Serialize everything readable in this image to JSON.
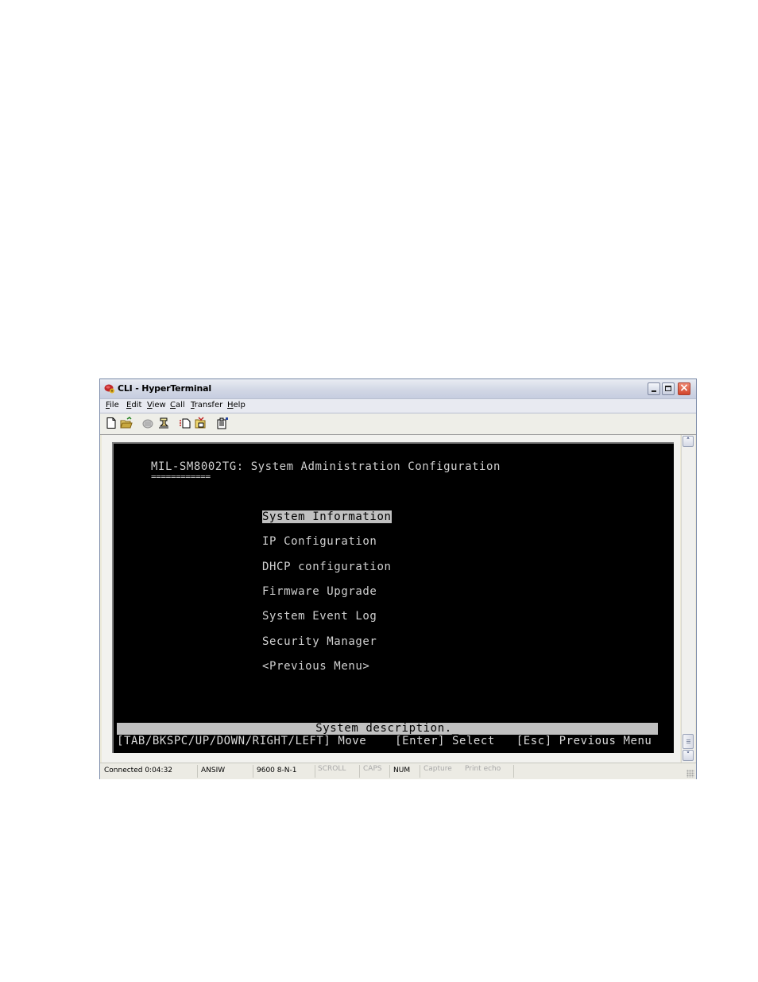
{
  "window": {
    "title": "CLI - HyperTerminal"
  },
  "menubar": {
    "items": [
      {
        "accel": "F",
        "rest": "ile"
      },
      {
        "accel": "E",
        "rest": "dit"
      },
      {
        "accel": "V",
        "rest": "iew"
      },
      {
        "accel": "C",
        "rest": "all"
      },
      {
        "accel": "T",
        "rest": "ransfer"
      },
      {
        "accel": "H",
        "rest": "elp"
      }
    ]
  },
  "toolbar": {
    "icons": [
      "new-icon",
      "open-icon",
      "call-icon",
      "disconnect-icon",
      "send-icon",
      "receive-icon",
      "properties-icon"
    ]
  },
  "terminal": {
    "heading": "MIL-SM8002TG: System Administration Configuration",
    "heading_underline": "============",
    "menu": [
      {
        "label": "System Information",
        "selected": true
      },
      {
        "label": "IP Configuration",
        "selected": false
      },
      {
        "label": "DHCP configuration",
        "selected": false
      },
      {
        "label": "Firmware Upgrade",
        "selected": false
      },
      {
        "label": "System Event Log",
        "selected": false
      },
      {
        "label": "Security Manager",
        "selected": false
      },
      {
        "label": "<Previous Menu>",
        "selected": false
      }
    ],
    "description": "System description._",
    "help": "[TAB/BKSPC/UP/DOWN/RIGHT/LEFT] Move    [Enter] Select   [Esc] Previous Menu"
  },
  "statusbar": {
    "connected": "Connected 0:04:32",
    "emulation": "ANSIW",
    "port_settings": "9600 8-N-1",
    "scroll": "SCROLL",
    "caps": "CAPS",
    "num": "NUM",
    "capture": "Capture",
    "print_echo": "Print echo"
  },
  "colors": {
    "terminal_bg": "#000000",
    "terminal_fg": "#d0d0d0",
    "highlight_bg": "#c0c0c0",
    "close_button": "#d2452a"
  }
}
